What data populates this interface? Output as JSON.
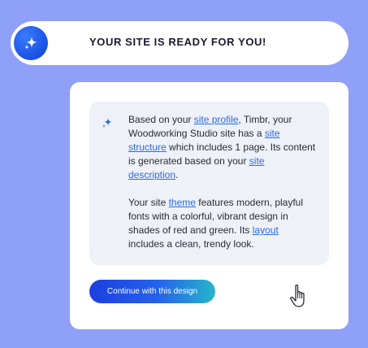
{
  "banner": {
    "title": "YOUR SITE IS READY FOR YOU!",
    "icon": "sparkle-icon"
  },
  "message": {
    "icon": "sparkle-icon",
    "p1": {
      "t1": "Based on your ",
      "link1": "site profile",
      "t2": ", Timbr, your Woodworking Studio site has a ",
      "link2": "site structure",
      "t3": " which includes 1 page. Its content is generated based on your ",
      "link3": "site description",
      "t4": "."
    },
    "p2": {
      "t1": "Your site ",
      "link1": "theme",
      "t2": " features modern, playful fonts with a colorful, vibrant design in shades of red and green. Its ",
      "link2": "layout",
      "t3": " includes a clean, trendy look."
    }
  },
  "cta": {
    "label": "Continue with this design"
  },
  "cursor": {
    "icon": "hand-pointer-icon"
  },
  "colors": {
    "background": "#8fa0f8",
    "accent": "#2563ea",
    "link": "#2a6ae8"
  }
}
